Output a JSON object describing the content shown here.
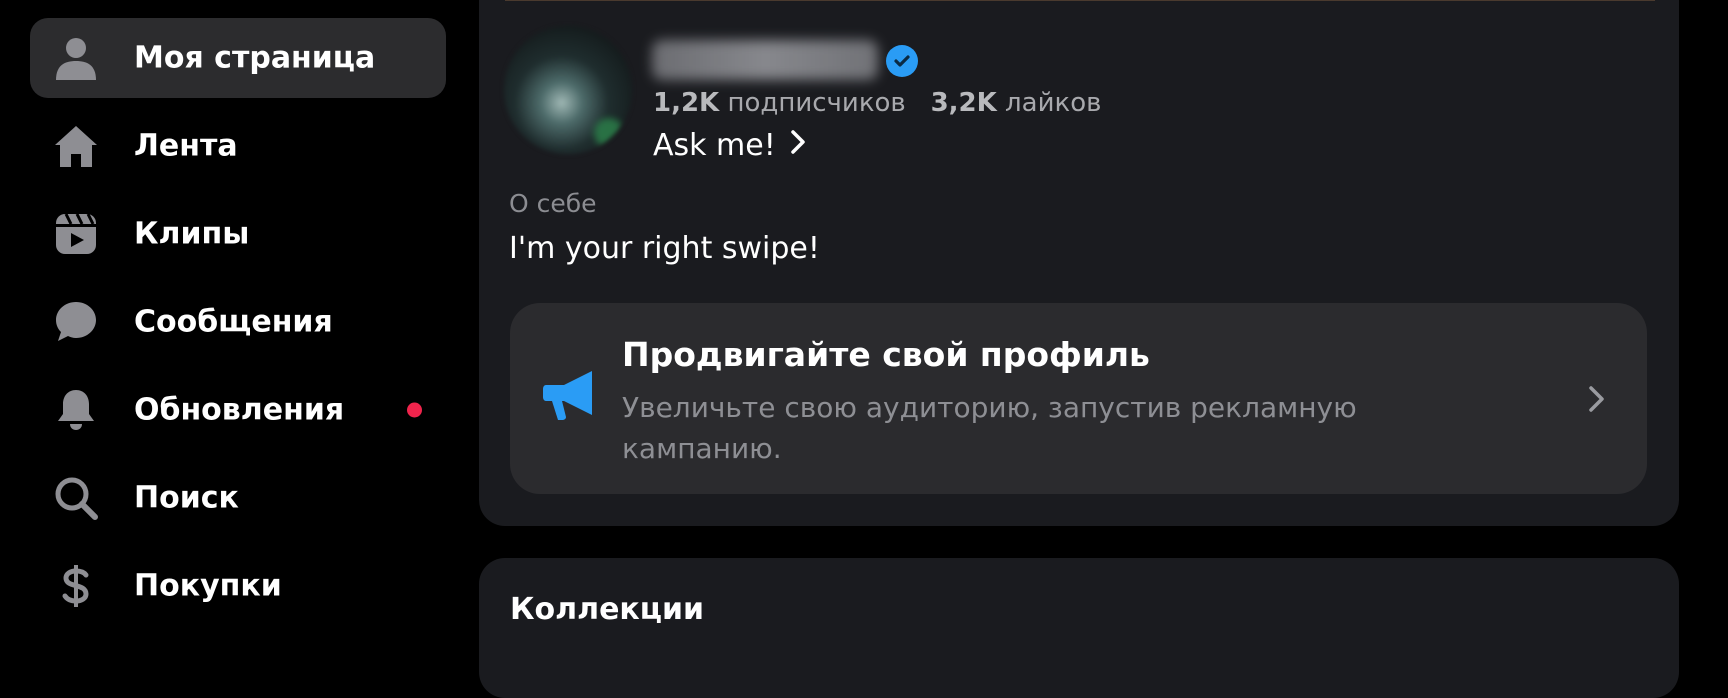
{
  "sidebar": {
    "items": [
      {
        "label": "Моя страница",
        "icon": "user-icon",
        "active": true
      },
      {
        "label": "Лента",
        "icon": "home-icon"
      },
      {
        "label": "Клипы",
        "icon": "clips-icon"
      },
      {
        "label": "Сообщения",
        "icon": "message-icon"
      },
      {
        "label": "Обновления",
        "icon": "bell-icon",
        "has_notification": true
      },
      {
        "label": "Поиск",
        "icon": "search-icon"
      },
      {
        "label": "Покупки",
        "icon": "dollar-icon"
      }
    ]
  },
  "profile": {
    "followers_count": "1,2K",
    "followers_label": "подписчиков",
    "likes_count": "3,2K",
    "likes_label": "лайков",
    "status": "Ask me!",
    "about_label": "О себе",
    "about_text": "I'm your right swipe!"
  },
  "promo": {
    "title": "Продвигайте свой профиль",
    "text": "Увеличьте свою аудиторию, запустив рекламную кампанию."
  },
  "collections": {
    "title": "Коллекции"
  },
  "colors": {
    "background": "#000000",
    "card": "#1a1b1f",
    "active_nav": "#2c2c2e",
    "accent_blue": "#2a9cf5",
    "notification": "#f0244c",
    "icon_gray": "#8e8e93"
  }
}
